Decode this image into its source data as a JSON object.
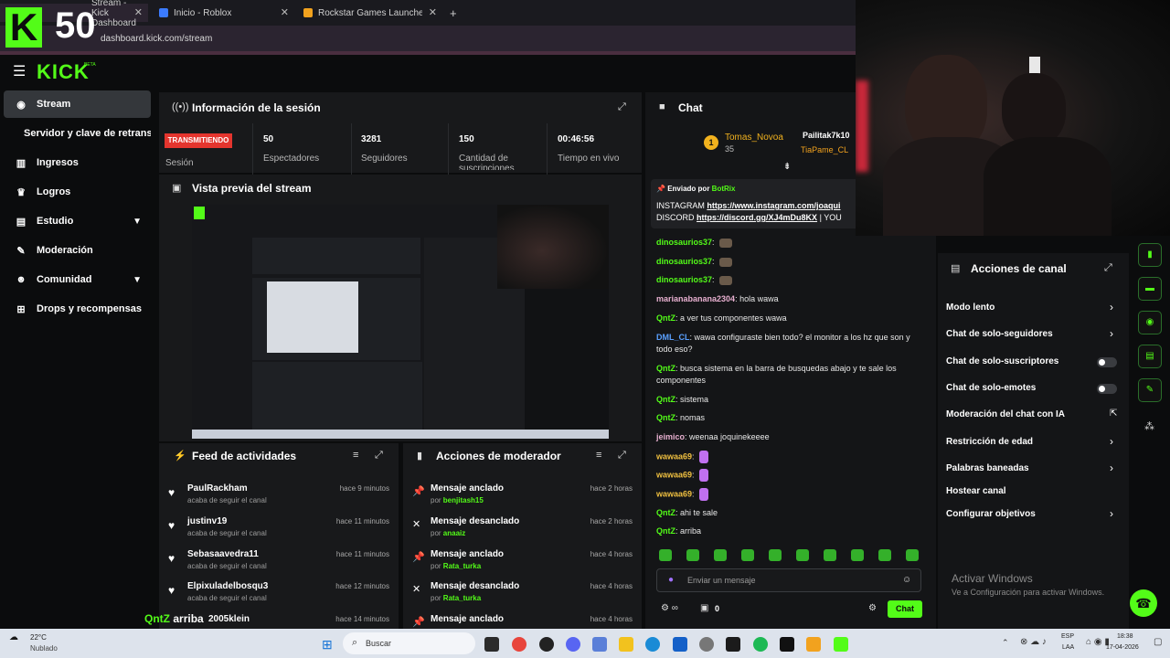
{
  "browser": {
    "tabs": [
      {
        "label": "Stream - Kick Dashboard"
      },
      {
        "label": "Inicio - Roblox"
      },
      {
        "label": "Rockstar Games Launcher - Roc"
      }
    ],
    "new_tab": "+",
    "address": "dashboard.kick.com/stream"
  },
  "overlay": {
    "logo": "K",
    "count": "50"
  },
  "header": {
    "logo": "KICK",
    "badge": "BETA"
  },
  "sidebar": {
    "items": [
      {
        "label": "Stream",
        "icon": "broadcast-icon"
      },
      {
        "label": "Servidor y clave de retransmisión",
        "icon": ""
      },
      {
        "label": "Ingresos",
        "icon": "chart-icon"
      },
      {
        "label": "Logros",
        "icon": "trophy-icon"
      },
      {
        "label": "Estudio",
        "icon": "studio-icon"
      },
      {
        "label": "Moderación",
        "icon": "wrench-icon"
      },
      {
        "label": "Comunidad",
        "icon": "community-icon"
      },
      {
        "label": "Drops y recompensas",
        "icon": "gift-icon"
      }
    ]
  },
  "session": {
    "title": "Información de la sesión",
    "status": "TRANSMITIENDO",
    "status_label": "Sesión",
    "stats": [
      {
        "value": "50",
        "label": "Espectadores"
      },
      {
        "value": "3281",
        "label": "Seguidores"
      },
      {
        "value": "150",
        "label": "Cantidad de suscripciones"
      },
      {
        "value": "00:46:56",
        "label": "Tiempo en vivo"
      }
    ]
  },
  "preview": {
    "title": "Vista previa del stream"
  },
  "feed": {
    "title": "Feed de actividades",
    "rows": [
      {
        "name": "PaulRackham",
        "sub": "acaba de seguir el canal",
        "time": "hace 9 minutos"
      },
      {
        "name": "justinv19",
        "sub": "acaba de seguir el canal",
        "time": "hace 11 minutos"
      },
      {
        "name": "Sebasaavedra11",
        "sub": "acaba de seguir el canal",
        "time": "hace 11 minutos"
      },
      {
        "name": "Elpixuladelbosqu3",
        "sub": "acaba de seguir el canal",
        "time": "hace 12 minutos"
      },
      {
        "name": "2005klein",
        "sub": "",
        "time": "hace 14 minutos"
      }
    ]
  },
  "moderator": {
    "title": "Acciones de moderador",
    "rows": [
      {
        "action": "Mensaje anclado",
        "by": "por",
        "user": "benjitash15",
        "time": "hace 2 horas"
      },
      {
        "action": "Mensaje desanclado",
        "by": "por",
        "user": "anaaiz",
        "time": "hace 2 horas"
      },
      {
        "action": "Mensaje anclado",
        "by": "por",
        "user": "Rata_turka",
        "time": "hace 4 horas"
      },
      {
        "action": "Mensaje desanclado",
        "by": "por",
        "user": "Rata_turka",
        "time": "hace 4 horas"
      },
      {
        "action": "Mensaje anclado",
        "by": "",
        "user": "",
        "time": "hace 4 horas"
      }
    ]
  },
  "chat": {
    "title": "Chat",
    "leader": {
      "rank": "1",
      "name": "Tomas_Novoa",
      "points": "35"
    },
    "leader2": "Pailitak7k10",
    "leader3": "TiaPame_CL",
    "pinned": {
      "sent_by": "Enviado por",
      "bot": "BotRix",
      "line1_prefix": "INSTAGRAM",
      "line1_link": "https://www.instagram.com/joaqui",
      "line2_prefix": "DISCORD",
      "line2_link": "https://discord.gg/XJ4mDu8KX",
      "line2_suffix": "| YOU"
    },
    "messages": [
      {
        "user": "dinosaurios37",
        "text": "",
        "color": "#53fc18",
        "emote": "brown"
      },
      {
        "user": "dinosaurios37",
        "text": "",
        "color": "#53fc18",
        "emote": "brown"
      },
      {
        "user": "dinosaurios37",
        "text": "",
        "color": "#53fc18",
        "emote": "brown"
      },
      {
        "user": "marianabanana2304",
        "text": "hola wawa",
        "color": "#e8b0d0",
        "emote": ""
      },
      {
        "user": "QntZ",
        "text": "a ver tus componentes wawa",
        "color": "#53fc18",
        "emote": ""
      },
      {
        "user": "DML_CL",
        "text": "wawa configuraste bien todo? el monitor a los hz que son y todo eso?",
        "color": "#5aa0ff",
        "emote": ""
      },
      {
        "user": "QntZ",
        "text": "busca sistema en la barra de busquedas abajo y te sale los componentes",
        "color": "#53fc18",
        "emote": ""
      },
      {
        "user": "QntZ",
        "text": "sistema",
        "color": "#53fc18",
        "emote": ""
      },
      {
        "user": "QntZ",
        "text": "nomas",
        "color": "#53fc18",
        "emote": ""
      },
      {
        "user": "jeimico",
        "text": "weenaa joquinekeeee",
        "color": "#e8b0d0",
        "emote": ""
      },
      {
        "user": "wawaa69",
        "text": "",
        "color": "#f0c040",
        "emote": "purple"
      },
      {
        "user": "wawaa69",
        "text": "",
        "color": "#f0c040",
        "emote": "purple"
      },
      {
        "user": "wawaa69",
        "text": "",
        "color": "#f0c040",
        "emote": "purple"
      },
      {
        "user": "QntZ",
        "text": "ahi te sale",
        "color": "#53fc18",
        "emote": ""
      },
      {
        "user": "QntZ",
        "text": "arriba",
        "color": "#53fc18",
        "emote": ""
      }
    ],
    "input_placeholder": "Enviar un mensaje",
    "count": "0",
    "send_label": "Chat"
  },
  "stream_caption": {
    "user": "QntZ",
    "text": "arriba"
  },
  "channel_actions": {
    "title": "Acciones de canal",
    "items": [
      {
        "label": "Modo lento",
        "type": "chevron"
      },
      {
        "label": "Chat de solo-seguidores",
        "type": "chevron"
      },
      {
        "label": "Chat de solo-suscriptores",
        "type": "toggle"
      },
      {
        "label": "Chat de solo-emotes",
        "type": "toggle"
      },
      {
        "label": "Moderación del chat con IA",
        "type": "external"
      },
      {
        "label": "Restricción de edad",
        "type": "chevron"
      },
      {
        "label": "Palabras baneadas",
        "type": "chevron"
      },
      {
        "label": "Hostear canal",
        "type": "none"
      },
      {
        "label": "Configurar objetivos",
        "type": "chevron"
      }
    ]
  },
  "activate": {
    "title": "Activar Windows",
    "sub": "Ve a Configuración para activar Windows."
  },
  "taskbar": {
    "weather_temp": "22°C",
    "weather_text": "Nublado",
    "search": "Buscar",
    "lang": "ESP",
    "lang2": "LAA",
    "time": "18:38",
    "date": "17-04-2026"
  },
  "colors": {
    "brand": "#53fc18",
    "live": "#e4352e",
    "panel": "#18191b"
  }
}
